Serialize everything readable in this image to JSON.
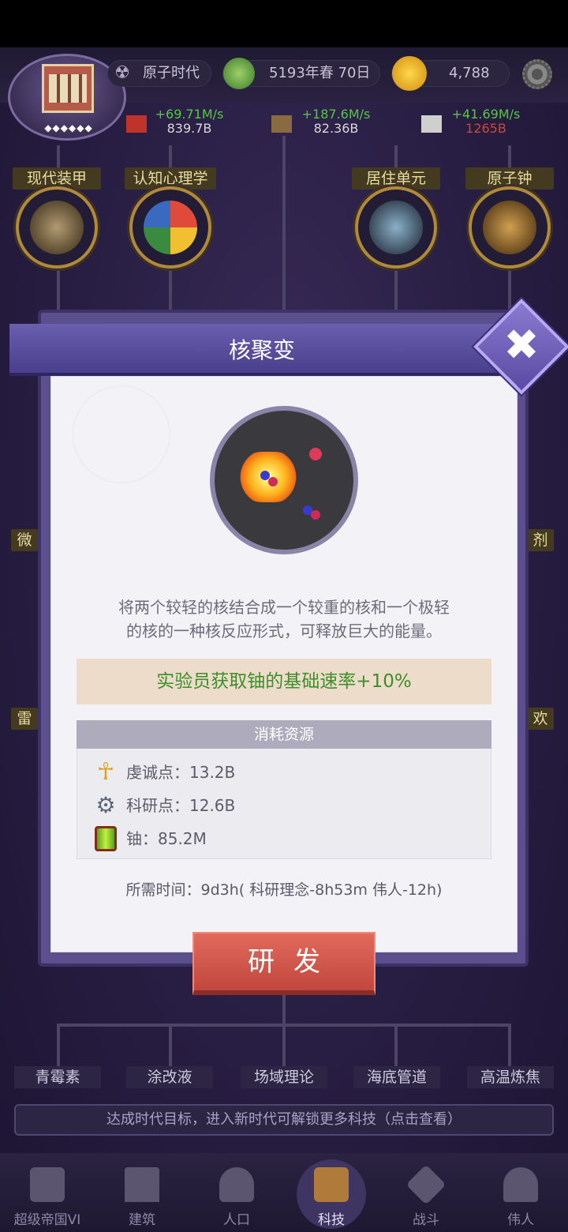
{
  "header": {
    "era_label": "原子时代",
    "date_label": "5193年春 70日",
    "coins": "4,788"
  },
  "resources": [
    {
      "rate": "+69.71M/s",
      "total": "839.7B",
      "total_color": "#d8d8d8"
    },
    {
      "rate": "+187.6M/s",
      "total": "82.36B",
      "total_color": "#d8d8d8"
    },
    {
      "rate": "+41.69M/s",
      "total": "1265B",
      "total_color": "#c84a3a"
    }
  ],
  "tech_nodes_top": [
    "现代装甲",
    "认知心理学",
    "居住单元",
    "原子钟"
  ],
  "side_labels": {
    "left1": "微",
    "right1": "剂",
    "left2": "雷",
    "right2": "欢"
  },
  "tech_nodes_bottom": [
    "青霉素",
    "涂改液",
    "场域理论",
    "海底管道",
    "高温炼焦"
  ],
  "goal_banner": "达成时代目标，进入新时代可解锁更多科技（点击查看）",
  "nav": [
    "超级帝国VI",
    "建筑",
    "人口",
    "科技",
    "战斗",
    "伟人"
  ],
  "modal": {
    "title": "核聚变",
    "close_symbol": "✖",
    "description_line1": "将两个较轻的核结合成一个较重的核和一个极轻",
    "description_line2": "的核的一种核反应形式，可释放巨大的能量。",
    "effect": "实验员获取铀的基础速率+10%",
    "cost_header": "消耗资源",
    "costs": [
      {
        "label": "虔诚点：13.2B",
        "icon": "ankh-icon"
      },
      {
        "label": "科研点：12.6B",
        "icon": "gears-icon"
      },
      {
        "label": "铀：85.2M",
        "icon": "uranium-barrel-icon"
      }
    ],
    "time_info": "所需时间：9d3h( 科研理念-8h53m 伟人-12h)",
    "research_button": "研发"
  },
  "colors": {
    "accent_purple": "#5b4f8e",
    "effect_green": "#3c8f2a",
    "button_red": "#c2473e"
  }
}
